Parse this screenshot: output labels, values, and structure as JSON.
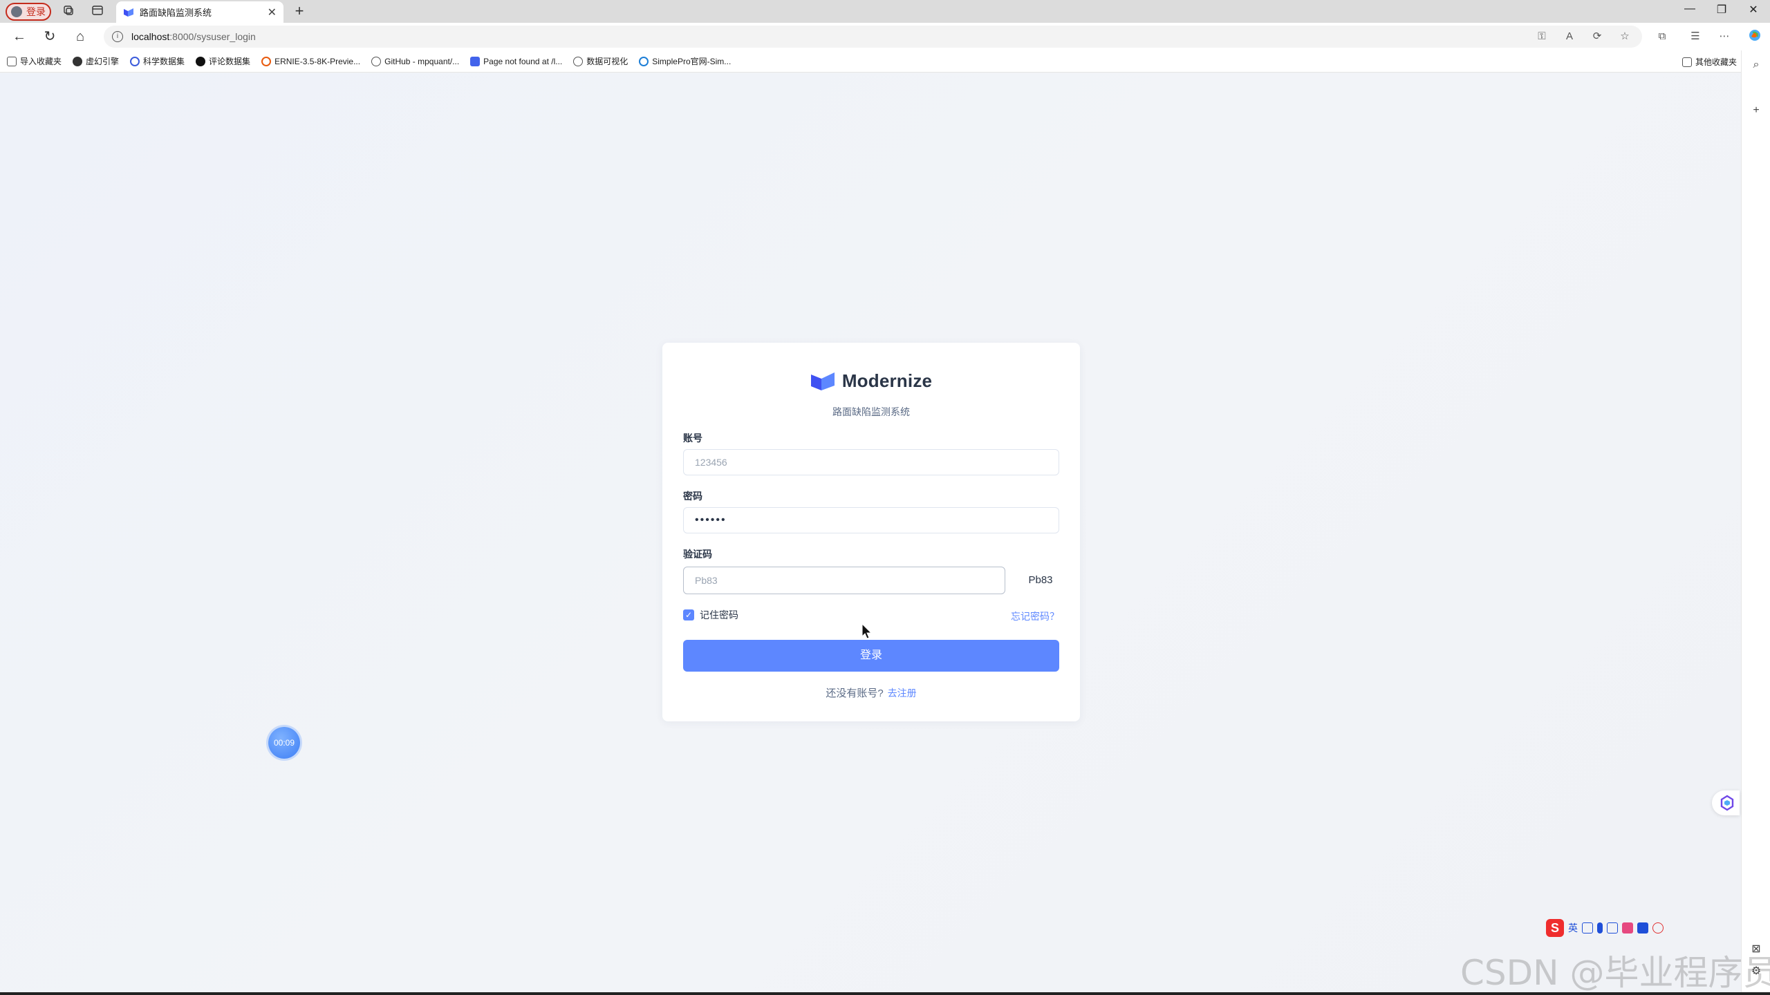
{
  "browser": {
    "profile_label": "登录",
    "tab_title": "路面缺陷监测系统",
    "url_host": "localhost",
    "url_path": ":8000/sysuser_login",
    "bookmarks": [
      {
        "label": "导入收藏夹",
        "color": "#6b7280"
      },
      {
        "label": "虚幻引擎",
        "color": "#333333"
      },
      {
        "label": "科学数据集",
        "color": "#3b5bdb"
      },
      {
        "label": "评论数据集",
        "color": "#111111"
      },
      {
        "label": "ERNIE-3.5-8K-Previe...",
        "color": "#e8590c"
      },
      {
        "label": "GitHub - mpquant/...",
        "color": "#555555"
      },
      {
        "label": "Page not found at /l...",
        "color": "#4263eb"
      },
      {
        "label": "数据可视化",
        "color": "#333333"
      },
      {
        "label": "SimplePro官网-Sim...",
        "color": "#1c7ed6"
      }
    ],
    "other_bookmarks": "其他收藏夹"
  },
  "login": {
    "brand_name": "Modernize",
    "subtitle": "路面缺陷监测系统",
    "account_label": "账号",
    "account_placeholder": "123456",
    "password_label": "密码",
    "password_mask": "••••••",
    "captcha_label": "验证码",
    "captcha_placeholder": "Pb83",
    "captcha_code": "Pb83",
    "remember_label": "记住密码",
    "remember_checked": true,
    "forgot_label": "忘记密码？",
    "login_button": "登录",
    "no_account_text": "还没有账号?",
    "register_link": "去注册"
  },
  "overlay": {
    "timer": "00:09",
    "ime_lang": "英",
    "watermark": "CSDN @毕业程序员"
  },
  "colors": {
    "accent": "#5d87ff",
    "heading": "#2a3547",
    "muted": "#5a6a85"
  }
}
